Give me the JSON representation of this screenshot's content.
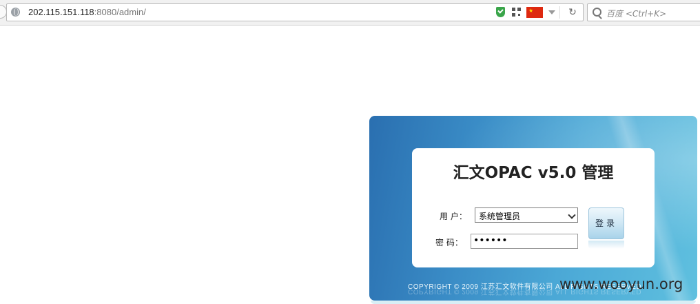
{
  "browser": {
    "url_host": "202.115.151.118",
    "url_rest": ":8080/admin/",
    "search_placeholder": "百度 <Ctrl+K>",
    "flag_stars": "★"
  },
  "login": {
    "title": "汇文OPAC v5.0 管理",
    "user_label": "用  户：",
    "user_value": "系统管理员",
    "password_label": "密  码：",
    "password_value": "••••••",
    "login_button": "登录"
  },
  "footer": {
    "copyright": "COPYRIGHT © 2009 江苏汇文软件有限公司 ALL RIGHTS RESERVED"
  },
  "watermark": "www.wooyun.org"
}
